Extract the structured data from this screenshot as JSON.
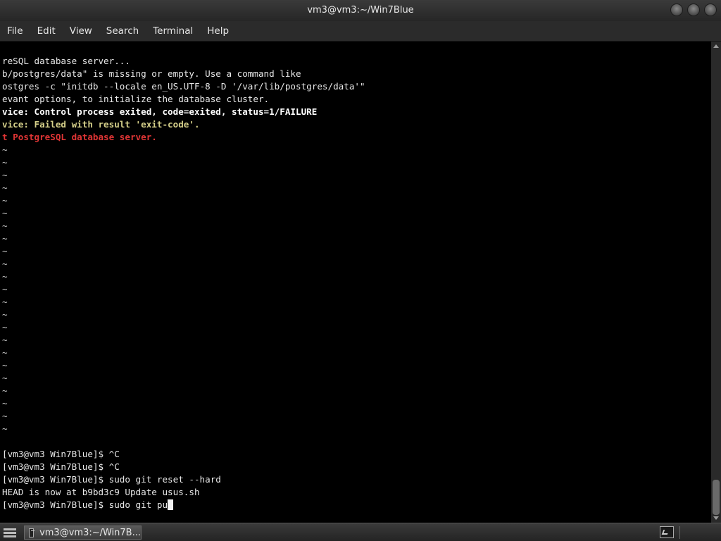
{
  "window": {
    "title": "vm3@vm3:~/Win7Blue"
  },
  "menu": {
    "file": "File",
    "edit": "Edit",
    "view": "View",
    "search": "Search",
    "terminal": "Terminal",
    "help": "Help"
  },
  "terminal": {
    "output": [
      {
        "text": "reSQL database server...",
        "style": "normal"
      },
      {
        "text": "b/postgres/data\" is missing or empty. Use a command like",
        "style": "normal"
      },
      {
        "text": "ostgres -c \"initdb --locale en_US.UTF-8 -D '/var/lib/postgres/data'\"",
        "style": "normal"
      },
      {
        "text": "evant options, to initialize the database cluster.",
        "style": "normal"
      },
      {
        "text": "vice: Control process exited, code=exited, status=1/FAILURE",
        "style": "bold"
      },
      {
        "text": "vice: Failed with result 'exit-code'.",
        "style": "yellow"
      },
      {
        "text": "t PostgreSQL database server.",
        "style": "red"
      }
    ],
    "tilde": "~",
    "commands": [
      "[vm3@vm3 Win7Blue]$ ^C",
      "[vm3@vm3 Win7Blue]$ ^C",
      "[vm3@vm3 Win7Blue]$ sudo git reset --hard",
      "HEAD is now at b9bd3c9 Update usus.sh",
      "[vm3@vm3 Win7Blue]$ sudo git pu"
    ]
  },
  "taskbar": {
    "task_label": "vm3@vm3:~/Win7B..."
  },
  "colors": {
    "yellow": "#d6d08a",
    "red": "#e03535",
    "background": "#000000"
  }
}
